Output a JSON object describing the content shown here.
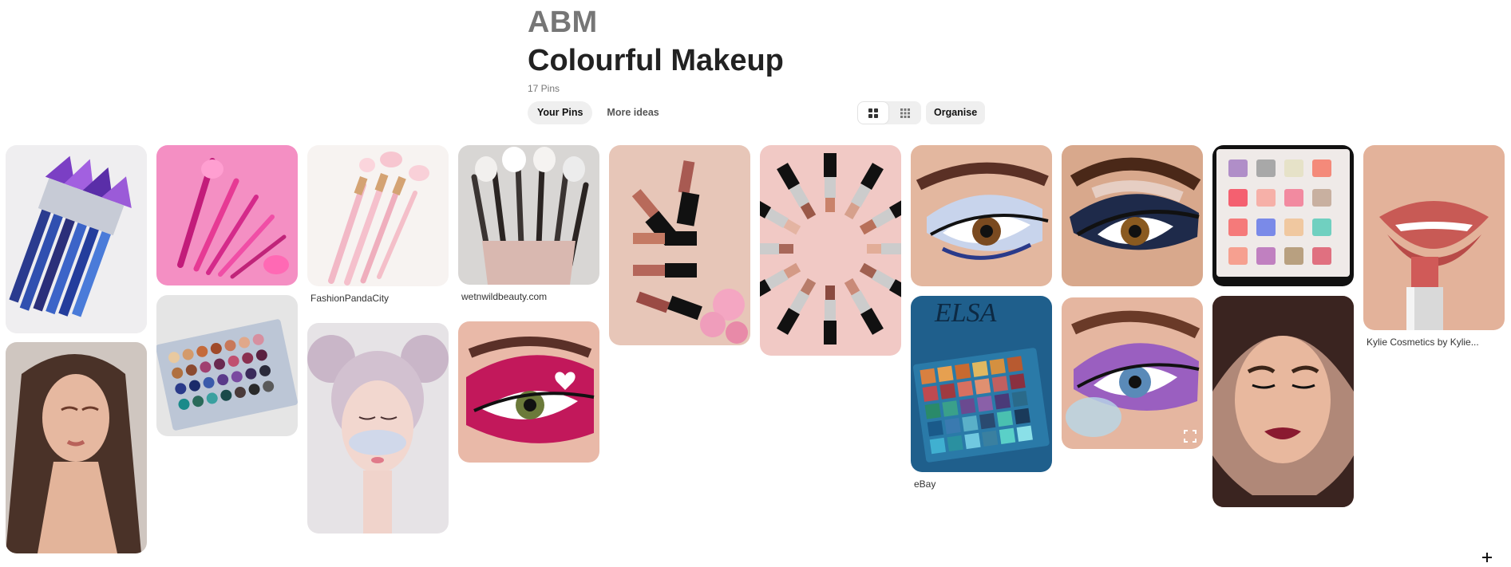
{
  "board": {
    "owner": "ABM",
    "title": "Colourful Makeup",
    "pin_count": "17 Pins"
  },
  "tabs": [
    {
      "label": "Your Pins",
      "active": true
    },
    {
      "label": "More ideas",
      "active": false
    }
  ],
  "tools": {
    "view_default_icon": "grid-2x2-icon",
    "view_compact_icon": "grid-3x3-icon",
    "organise_label": "Organise"
  },
  "pins": [
    {
      "subject": "purple brush set"
    },
    {
      "subject": "pink brushes"
    },
    {
      "subject": "glitter brushes",
      "source": "FashionPandaCity"
    },
    {
      "subject": "brush cup",
      "source": "wetnwildbeauty.com"
    },
    {
      "subject": "lipsticks fan"
    },
    {
      "subject": "lipsticks circle"
    },
    {
      "subject": "blue eye"
    },
    {
      "subject": "smoky eye"
    },
    {
      "subject": "pastel palette"
    },
    {
      "subject": "red lips",
      "source": "Kylie Cosmetics by Kylie..."
    },
    {
      "subject": "portrait woman"
    },
    {
      "subject": "jaclyn palette"
    },
    {
      "subject": "pastel face"
    },
    {
      "subject": "heart eye"
    },
    {
      "subject": "elsa palette",
      "source": "eBay"
    },
    {
      "subject": "glitter eye"
    },
    {
      "subject": "woman dark lips"
    }
  ],
  "colors": {
    "background": "#ffffff",
    "chip": "#efefef",
    "text": "#333333",
    "muted": "#767676"
  }
}
